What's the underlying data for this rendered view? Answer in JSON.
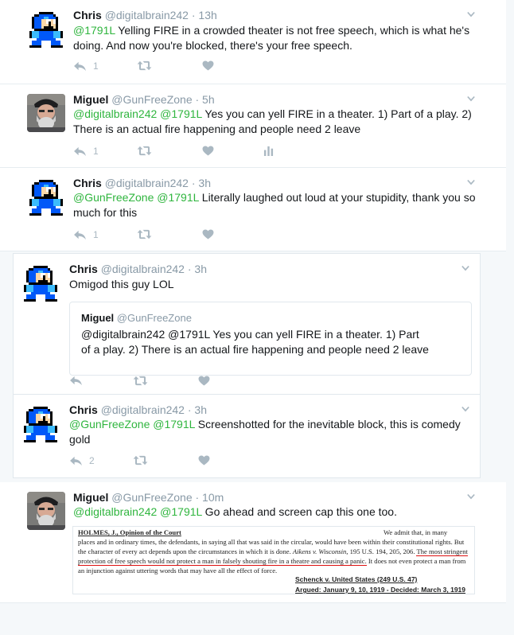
{
  "tweets": [
    {
      "name": "Chris",
      "handle": "@digitalbrain242",
      "time": "· 13h",
      "mentions": "@1791L",
      "text": " Yelling FIRE in a crowded theater is not free speech, which is what he's doing. And now you're blocked, there's your free speech.",
      "reply_count": "1"
    },
    {
      "name": "Miguel",
      "handle": "@GunFreeZone",
      "time": "· 5h",
      "mentions": "@digitalbrain242 @1791L",
      "text": " Yes you can yell FIRE in a theater. 1) Part of a play. 2) There is an actual fire happening and people need 2 leave",
      "reply_count": "1"
    },
    {
      "name": "Chris",
      "handle": "@digitalbrain242",
      "time": "· 3h",
      "mentions": "@GunFreeZone @1791L",
      "text": " Literally laughed out loud at your stupidity, thank you so much for this",
      "reply_count": "1"
    },
    {
      "name": "Chris",
      "handle": "@digitalbrain242",
      "time": "· 3h",
      "text": "Omigod this guy LOL",
      "quote": {
        "name": "Miguel",
        "handle": "@GunFreeZone",
        "text": "@digitalbrain242 @1791L Yes you can yell FIRE in a theater. 1) Part of a play. 2) There is an actual fire happening and people need 2 leave"
      }
    },
    {
      "name": "Chris",
      "handle": "@digitalbrain242",
      "time": "· 3h",
      "mentions": "@GunFreeZone @1791L",
      "text": " Screenshotted for the inevitable block, this is comedy gold",
      "reply_count": "2"
    },
    {
      "name": "Miguel",
      "handle": "@GunFreeZone",
      "time": "· 10m",
      "mentions": "@digitalbrain242 @1791L",
      "text": " Go ahead and screen cap this one too.",
      "attachment": {
        "heading": "HOLMES, J., Opinion of the Court",
        "line1_tail": "We admit that, in many",
        "para_a": "places and in ordinary times, the defendants, in saying all that was said in the circular, would have been within their constitutional rights. But the character of every act depends upon the circumstances in which it is done.",
        "case1": "Aikens v. Wisconsin,",
        "case1_cite": "195 U.S. 194, 205, 206.",
        "underlined": "The most stringent protection of free speech would not protect a man in falsely shouting fire in a theatre and causing a panic.",
        "para_b": "It does not even protect a man from an injunction against uttering words that may have all the effect of force.",
        "case_name": "Schenck v. United States (249 U.S. 47)",
        "argued": "Argued: January 9, 10, 1919 - Decided: March 3, 1919"
      }
    }
  ],
  "icons": {
    "reply": "reply-icon",
    "retweet": "retweet-icon",
    "like": "heart-icon",
    "analytics": "analytics-icon",
    "more": "chevron-down-icon"
  },
  "colors": {
    "mention": "#2fb53e",
    "icon_gray": "#aab8c2",
    "handle_gray": "#8899a6"
  }
}
